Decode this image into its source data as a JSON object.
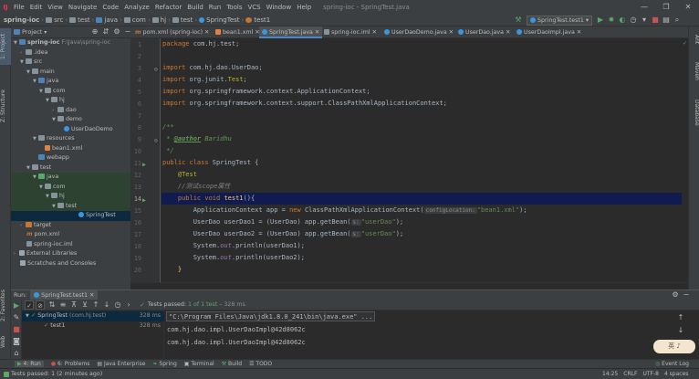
{
  "menu": {
    "items": [
      "File",
      "Edit",
      "View",
      "Navigate",
      "Code",
      "Analyze",
      "Refactor",
      "Build",
      "Run",
      "Tools",
      "VCS",
      "Window",
      "Help"
    ],
    "window_title": "spring-ioc - SpringTest.java"
  },
  "nav": {
    "crumbs": [
      "spring-ioc",
      "src",
      "test",
      "java",
      "com",
      "hj",
      "test",
      "SpringTest",
      "test1"
    ],
    "run_config": "SpringTest.test1"
  },
  "left_stripe": {
    "project": "1: Project",
    "structure": "Z: Structure",
    "favorites": "2: Favorites",
    "web": "Web"
  },
  "right_stripe": {
    "ant": "Ant",
    "maven": "Maven",
    "database": "Database"
  },
  "project_panel": {
    "title": "Project",
    "tree": [
      {
        "label": "spring-ioc",
        "extra": "F:\\Java\\spring-ioc"
      },
      {
        "label": ".idea"
      },
      {
        "label": "src"
      },
      {
        "label": "main"
      },
      {
        "label": "java"
      },
      {
        "label": "com"
      },
      {
        "label": "hj"
      },
      {
        "label": "dao"
      },
      {
        "label": "demo"
      },
      {
        "label": "UserDaoDemo"
      },
      {
        "label": "resources"
      },
      {
        "label": "bean1.xml"
      },
      {
        "label": "webapp"
      },
      {
        "label": "test"
      },
      {
        "label": "java"
      },
      {
        "label": "com"
      },
      {
        "label": "hj"
      },
      {
        "label": "test"
      },
      {
        "label": "SpringTest"
      },
      {
        "label": "target"
      },
      {
        "label": "pom.xml"
      },
      {
        "label": "spring-ioc.iml"
      },
      {
        "label": "External Libraries"
      },
      {
        "label": "Scratches and Consoles"
      }
    ]
  },
  "editor": {
    "tabs": [
      "pom.xml (spring-ioc)",
      "bean1.xml",
      "SpringTest.java",
      "spring-ioc.iml",
      "UserDaoDemo.java",
      "UserDao.java",
      "UserDaoImpl.java"
    ],
    "line_numbers": [
      "1",
      "2",
      "3",
      "4",
      "5",
      "6",
      "7",
      "8",
      "9",
      "10",
      "11",
      "12",
      "13",
      "14",
      "15",
      "16",
      "17",
      "18",
      "19",
      "20"
    ],
    "code": {
      "l1a": "package ",
      "l1b": "com.hj.test;",
      "l3a": "import ",
      "l3b": "com.hj.dao.UserDao;",
      "l4a": "import ",
      "l4b": "org.junit.",
      "l4c": "Test",
      "l4d": ";",
      "l5a": "import ",
      "l5b": "org.springframework.context.ApplicationContext;",
      "l6a": "import ",
      "l6b": "org.springframework.context.support.ClassPathXmlApplicationContext;",
      "l8": "/**",
      "l9a": " * ",
      "l9b": "@author",
      "l9c": " Baridhu",
      "l10": " */",
      "l11a": "public class ",
      "l11b": "SpringTest {",
      "l12": "    @Test",
      "l13": "    //测试scope属性",
      "l14a": "    public void ",
      "l14b": "test1",
      "l14c": "(){",
      "l15a": "        ApplicationContext app = ",
      "l15b": "new ",
      "l15c": "ClassPathXmlApplicationContext(",
      "l15hint": "configLocation:",
      "l15d": "\"bean1.xml\"",
      "l15e": ");",
      "l16a": "        UserDao userDao1 = (UserDao) app.getBean(",
      "l16hint": "s:",
      "l16b": "\"userDao\"",
      "l16c": ");",
      "l17a": "        UserDao userDao2 = (UserDao) app.getBean(",
      "l17hint": "s:",
      "l17b": "\"userDao\"",
      "l17c": ");",
      "l18a": "        System.",
      "l18b": "out",
      "l18c": ".println(userDao1);",
      "l19a": "        System.",
      "l19b": "out",
      "l19c": ".println(userDao2);",
      "l20": "    }"
    }
  },
  "run_panel": {
    "header": "Run:",
    "tab": "SpringTest.test1",
    "status_prefix": "Tests passed:",
    "status_count": "1 of 1 test",
    "status_time": "– 328 ms",
    "tree": [
      {
        "label": "SpringTest",
        "extra": "(com.hj.test)",
        "time": "328 ms"
      },
      {
        "label": "test1",
        "extra": "",
        "time": "328 ms"
      }
    ],
    "console": [
      "\"C:\\Program Files\\Java\\jdk1.8.0_241\\bin\\java.exe\" ...",
      "com.hj.dao.impl.UserDaoImpl@42d8062c",
      "com.hj.dao.impl.UserDaoImpl@42d8062c"
    ]
  },
  "bottom_tools": [
    "4: Run",
    "6: Problems",
    "Java Enterprise",
    "Spring",
    "Terminal",
    "Build",
    "TODO"
  ],
  "bottom_right": "Event Log",
  "status": {
    "message": "Tests passed: 1 (2 minutes ago)",
    "position": "14:25",
    "line_sep": "CRLF",
    "encoding": "UTF-8",
    "indent": "4 spaces"
  },
  "toast_text": "英 ♪"
}
